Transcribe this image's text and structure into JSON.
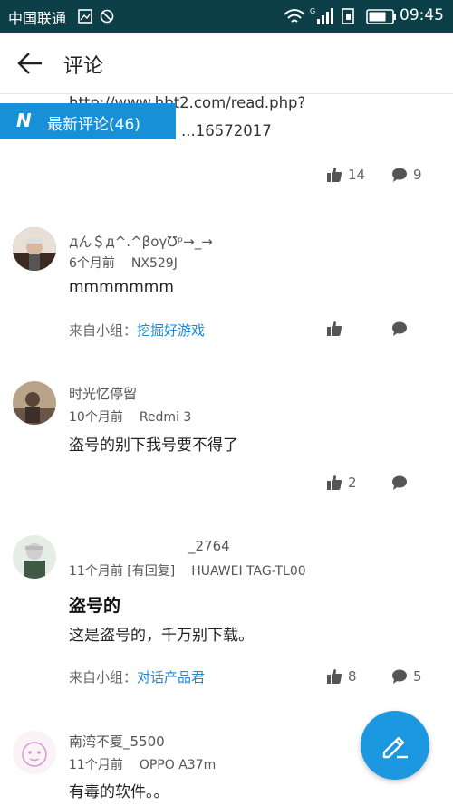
{
  "status_bar": {
    "carrier": "中国联通",
    "time": "09:45",
    "background": "#0c3f48"
  },
  "header": {
    "title": "评论"
  },
  "badge": {
    "letter": "N",
    "label": "最新评论(46)",
    "color": "#1790d8"
  },
  "previous_comment": {
    "line1": "http://www.hbt2.com/read.php?",
    "line2": "...16572017",
    "likes": "14",
    "comments": "9"
  },
  "comments": [
    {
      "username": "дん＄д^.^βογ℧ᵖ→_→",
      "time": "6个月前",
      "device": "NX529J",
      "text": "mmmmmmm",
      "from_prefix": "来自小组：",
      "group": "挖掘好游戏",
      "likes": "",
      "replies": ""
    },
    {
      "username": "时光忆停留",
      "time": "10个月前",
      "device": "Redmi 3",
      "text": "盗号的别下我号要不得了",
      "likes": "2",
      "replies": ""
    },
    {
      "username": "_2764",
      "time": "11个月前 [有回复]",
      "device": "HUAWEI TAG-TL00",
      "title": "盗号的",
      "text": "这是盗号的，千万别下载。",
      "from_prefix": "来自小组：",
      "group": "对话产品君",
      "likes": "8",
      "replies": "5"
    },
    {
      "username": "南湾不夏_5500",
      "time": "11个月前",
      "device": "OPPO A37m",
      "text": "有毒的软件。。"
    }
  ],
  "colors": {
    "accent": "#1a8ad4",
    "fab": "#1c98e0"
  },
  "icons": [
    "wifi-icon",
    "signal-icon",
    "battery-icon",
    "back-arrow-icon",
    "thumbs-up-icon",
    "comment-bubble-icon",
    "edit-pencil-icon"
  ]
}
